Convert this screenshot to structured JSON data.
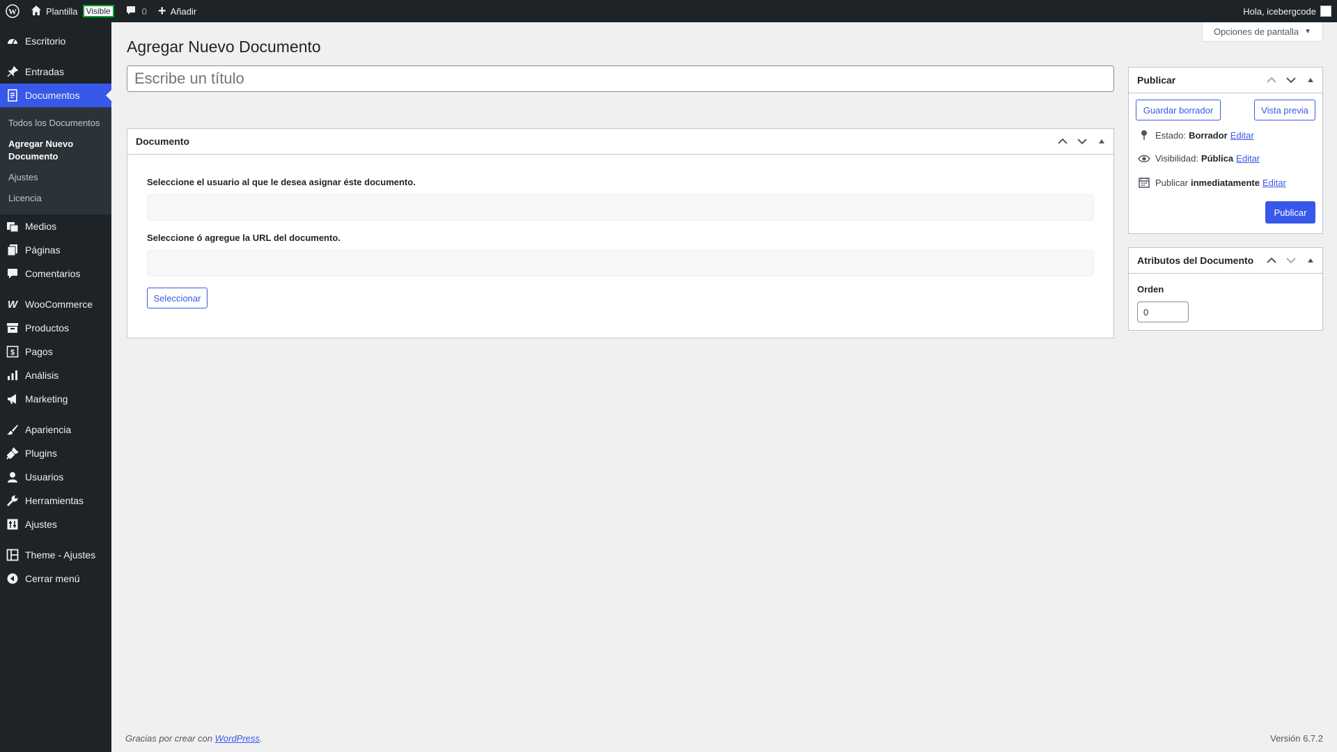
{
  "adminbar": {
    "site_name": "Plantilla",
    "visibility_badge": "Visible",
    "comments_count": "0",
    "add_new": "Añadir",
    "greeting": "Hola, icebergcode"
  },
  "sidebar": {
    "items": [
      {
        "label": "Escritorio",
        "icon": "dashboard-icon"
      },
      {
        "label": "Entradas",
        "icon": "pin-icon"
      },
      {
        "label": "Documentos",
        "icon": "document-icon"
      },
      {
        "label": "Medios",
        "icon": "media-icon"
      },
      {
        "label": "Páginas",
        "icon": "pages-icon"
      },
      {
        "label": "Comentarios",
        "icon": "comment-icon"
      },
      {
        "label": "WooCommerce",
        "icon": "woocommerce-icon"
      },
      {
        "label": "Productos",
        "icon": "archive-icon"
      },
      {
        "label": "Pagos",
        "icon": "payments-icon"
      },
      {
        "label": "Análisis",
        "icon": "chart-icon"
      },
      {
        "label": "Marketing",
        "icon": "megaphone-icon"
      },
      {
        "label": "Apariencia",
        "icon": "brush-icon"
      },
      {
        "label": "Plugins",
        "icon": "plugin-icon"
      },
      {
        "label": "Usuarios",
        "icon": "user-icon"
      },
      {
        "label": "Herramientas",
        "icon": "wrench-icon"
      },
      {
        "label": "Ajustes",
        "icon": "settings-icon"
      },
      {
        "label": "Theme - Ajustes",
        "icon": "layout-icon"
      },
      {
        "label": "Cerrar menú",
        "icon": "collapse-icon"
      }
    ],
    "submenu": [
      {
        "label": "Todos los Documentos"
      },
      {
        "label": "Agregar Nuevo Documento"
      },
      {
        "label": "Ajustes"
      },
      {
        "label": "Licencia"
      }
    ]
  },
  "header": {
    "screen_options": "Opciones de pantalla",
    "page_title": "Agregar Nuevo Documento",
    "title_placeholder": "Escribe un título"
  },
  "document_box": {
    "title": "Documento",
    "user_label": "Seleccione el usuario al que le desea asignar éste documento.",
    "url_label": "Seleccione ó agregue la URL del documento.",
    "select_button": "Seleccionar"
  },
  "publish_box": {
    "title": "Publicar",
    "save_draft": "Guardar borrador",
    "preview": "Vista previa",
    "status_label": "Estado:",
    "status_value": "Borrador",
    "visibility_label": "Visibilidad:",
    "visibility_value": "Pública",
    "schedule_label": "Publicar",
    "schedule_value": "inmediatamente",
    "edit_link": "Editar",
    "publish_button": "Publicar"
  },
  "attributes_box": {
    "title": "Atributos del Documento",
    "order_label": "Orden",
    "order_value": "0"
  },
  "footer": {
    "thanks": "Gracias por crear con",
    "wordpress_link": "WordPress",
    "version": "Versión 6.7.2"
  },
  "colors": {
    "accent": "#3858e9",
    "sidebar_bg": "#1d2327",
    "content_bg": "#f0f0f1"
  }
}
